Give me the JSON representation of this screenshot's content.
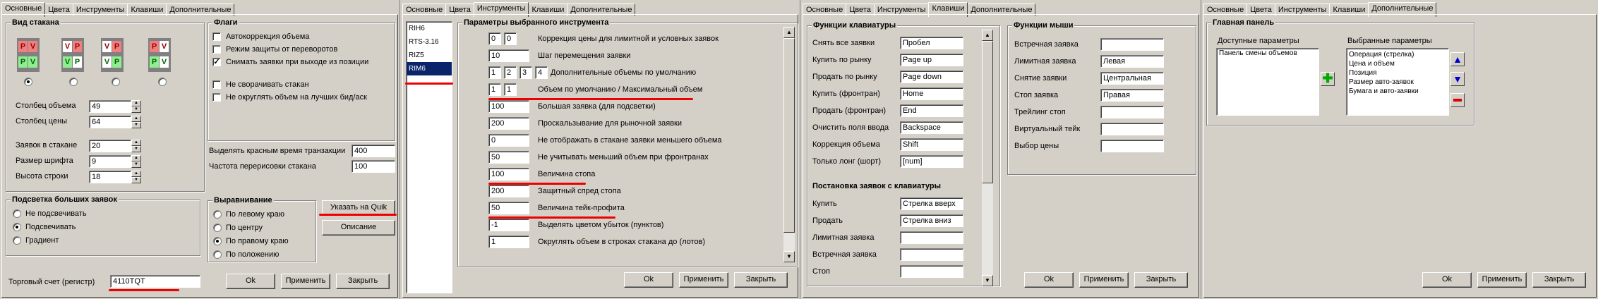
{
  "colors": {
    "accent_red": "#e00000",
    "selection": "#0a246a"
  },
  "p1": {
    "tabs": [
      "Основные",
      "Цвета",
      "Инструменты",
      "Клавиши",
      "Дополнительные"
    ],
    "glass_group": "Вид стакана",
    "pv": [
      "P",
      "V"
    ],
    "col_volume_label": "Столбец объема",
    "col_volume": "49",
    "col_price_label": "Столбец цены",
    "col_price": "64",
    "orders_label": "Заявок в стакане",
    "orders": "20",
    "font_label": "Размер шрифта",
    "font": "9",
    "row_label": "Высота строки",
    "row": "18",
    "flags_group": "Флаги",
    "flags": [
      "Автокоррекция объема",
      "Режим защиты от переворотов",
      "Снимать заявки при выходе из позиции",
      "Не сворачивать стакан",
      "Не округлять объем на лучших бид/аск"
    ],
    "redtime_label": "Выделять красным время транзакции",
    "redtime": "400",
    "refresh_label": "Частота перерисовки стакана",
    "refresh": "100",
    "big_group": "Подсветка больших заявок",
    "big_opts": [
      "Не подсвечивать",
      "Подсвечивать",
      "Градиент"
    ],
    "align_group": "Выравнивание",
    "align_opts": [
      "По левому краю",
      "По центру",
      "По правому краю",
      "По положению"
    ],
    "quik_btn": "Указать на Quik",
    "desc_btn": "Описание",
    "account_label": "Торговый счет (регистр)",
    "account": "4110TQT",
    "ok": "Ok",
    "apply": "Применить",
    "close": "Закрыть"
  },
  "p2": {
    "tabs": [
      "Основные",
      "Цвета",
      "Инструменты",
      "Клавиши",
      "Дополнительные"
    ],
    "instruments": [
      "RIH6",
      "RTS-3.16",
      "RIZ5",
      "RIM6"
    ],
    "group": "Параметры выбранного инструмента",
    "rows": [
      {
        "vals": [
          "0",
          "0"
        ],
        "label": "Коррекция цены для лимитной и условных заявок"
      },
      {
        "vals": [
          "10"
        ],
        "label": "Шаг перемещения заявки"
      },
      {
        "vals": [
          "1",
          "2",
          "3",
          "4"
        ],
        "label": "Дополнительные объемы по умолчанию"
      },
      {
        "vals": [
          "1",
          "1"
        ],
        "label": "Объем по умолчанию / Максимальный объем"
      },
      {
        "vals": [
          "100"
        ],
        "label": "Большая заявка (для подсветки)"
      },
      {
        "vals": [
          "200"
        ],
        "label": "Проскальзывание для рыночной заявки"
      },
      {
        "vals": [
          "0"
        ],
        "label": "Не отображать в стакане заявки меньшего объема"
      },
      {
        "vals": [
          "50"
        ],
        "label": "Не учитывать меньший объем при фронтранах"
      },
      {
        "vals": [
          "100"
        ],
        "label": "Величина стопа"
      },
      {
        "vals": [
          "200"
        ],
        "label": "Защитный спред стопа"
      },
      {
        "vals": [
          "50"
        ],
        "label": "Величина тейк-профита"
      },
      {
        "vals": [
          "-1"
        ],
        "label": "Выделять цветом убыток (пунктов)"
      },
      {
        "vals": [
          "1"
        ],
        "label": "Округлять объем в строках стакана до (лотов)"
      }
    ],
    "ok": "Ok",
    "apply": "Применить",
    "close": "Закрыть"
  },
  "p3": {
    "tabs": [
      "Основные",
      "Цвета",
      "Инструменты",
      "Клавиши",
      "Дополнительные"
    ],
    "kbd_group": "Функции клавиатуры",
    "kbd": [
      [
        "Снять все заявки",
        "Пробел"
      ],
      [
        "Купить по рынку",
        "Page up"
      ],
      [
        "Продать по рынку",
        "Page down"
      ],
      [
        "Купить (фронтран)",
        "Home"
      ],
      [
        "Продать (фронтран)",
        "End"
      ],
      [
        "Очистить поля ввода",
        "Backspace"
      ],
      [
        "Коррекция объема",
        "Shift"
      ],
      [
        "Только лонг (шорт)",
        "[num]"
      ]
    ],
    "place_group": "Постановка заявок с клавиатуры",
    "place": [
      [
        "Купить",
        "Стрелка вверх"
      ],
      [
        "Продать",
        "Стрелка вниз"
      ],
      [
        "Лимитная заявка",
        ""
      ],
      [
        "Встречная заявка",
        ""
      ],
      [
        "Стоп",
        ""
      ]
    ],
    "mouse_group": "Функции мыши",
    "mouse": [
      [
        "Встречная заявка",
        ""
      ],
      [
        "Лимитная заявка",
        "Левая"
      ],
      [
        "Снятие заявки",
        "Центральная"
      ],
      [
        "Стоп заявка",
        "Правая"
      ],
      [
        "Трейлинг стоп",
        ""
      ],
      [
        "Виртуальный тейк",
        ""
      ],
      [
        "Выбор цены",
        ""
      ]
    ],
    "ok": "Ok",
    "apply": "Применить",
    "close": "Закрыть"
  },
  "p4": {
    "tabs": [
      "Основные",
      "Цвета",
      "Инструменты",
      "Клавиши",
      "Дополнительные"
    ],
    "group": "Главная панель",
    "avail_label": "Доступные параметры",
    "avail": [
      "Панель смены объемов"
    ],
    "sel_label": "Выбранные параметры",
    "selected": [
      "Операция (стрелка)",
      "Цена и объем",
      "Позиция",
      "Размер авто-заявок",
      "Бумага и авто-заявки"
    ],
    "ok": "Ok",
    "apply": "Применить",
    "close": "Закрыть"
  }
}
